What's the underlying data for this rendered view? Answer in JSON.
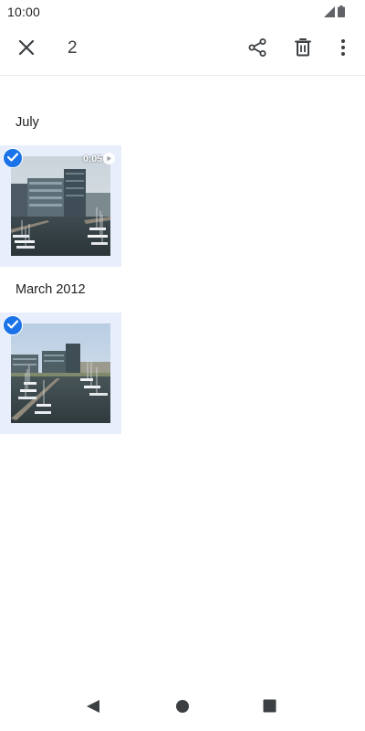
{
  "status_bar": {
    "time": "10:00",
    "icons": [
      "signal-icon",
      "battery-icon"
    ]
  },
  "action_bar": {
    "selected_count": "2",
    "icons": [
      "close-icon",
      "share-icon",
      "delete-icon",
      "more-vert-icon"
    ]
  },
  "sections": [
    {
      "title": "July",
      "items": [
        {
          "type": "video",
          "duration": "0:05",
          "selected": true
        }
      ]
    },
    {
      "title": "March 2012",
      "items": [
        {
          "type": "photo",
          "selected": true
        }
      ]
    }
  ],
  "nav_bar": {
    "icons": [
      "back-icon",
      "home-icon",
      "recents-icon"
    ]
  },
  "colors": {
    "accent": "#1a73e8",
    "selection_background": "#e8eefb",
    "icon": "#3c4043"
  }
}
